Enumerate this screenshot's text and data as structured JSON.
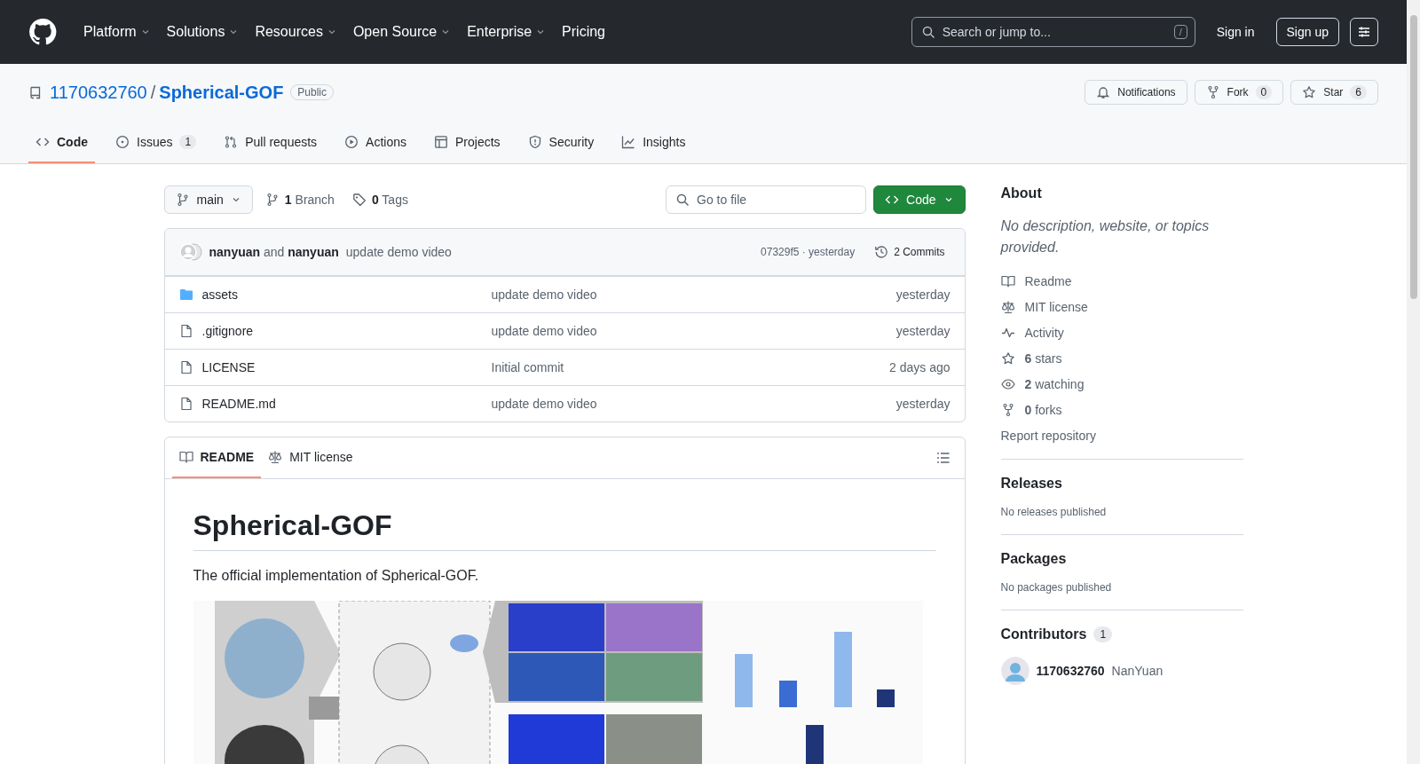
{
  "header": {
    "nav": [
      {
        "label": "Platform",
        "dropdown": true
      },
      {
        "label": "Solutions",
        "dropdown": true
      },
      {
        "label": "Resources",
        "dropdown": true
      },
      {
        "label": "Open Source",
        "dropdown": true
      },
      {
        "label": "Enterprise",
        "dropdown": true
      },
      {
        "label": "Pricing",
        "dropdown": false
      }
    ],
    "search": {
      "placeholder": "Search or jump to...",
      "shortcut": "/"
    },
    "sign_in": "Sign in",
    "sign_up": "Sign up"
  },
  "repo": {
    "owner": "1170632760",
    "separator": "/",
    "name": "Spherical-GOF",
    "visibility": "Public",
    "actions": [
      {
        "kind": "bell",
        "label": "Notifications"
      },
      {
        "kind": "fork",
        "label": "Fork",
        "count": "0"
      },
      {
        "kind": "star",
        "label": "Star",
        "count": "6"
      }
    ]
  },
  "tabs": [
    {
      "kind": "code",
      "label": "Code",
      "selected": true
    },
    {
      "kind": "issue",
      "label": "Issues",
      "count": "1",
      "selected": false
    },
    {
      "kind": "pull",
      "label": "Pull requests",
      "selected": false
    },
    {
      "kind": "play",
      "label": "Actions",
      "selected": false
    },
    {
      "kind": "table",
      "label": "Projects",
      "selected": false
    },
    {
      "kind": "shield",
      "label": "Security",
      "selected": false
    },
    {
      "kind": "graph",
      "label": "Insights",
      "selected": false
    }
  ],
  "toolbar": {
    "branch": "main",
    "branches": "**1** Branch",
    "tags": "**0** Tags",
    "go_to_file": {
      "placeholder": "Go to file"
    },
    "code_button": "Code"
  },
  "commit": {
    "authors": "**nanyuan** and **nanyuan**",
    "message": "update demo video",
    "hash_time": "07329f5 · yesterday",
    "commits": "2 Commits"
  },
  "files": [
    {
      "kind": "folder",
      "name": "assets",
      "message": "update demo video",
      "time": "yesterday"
    },
    {
      "kind": "file",
      "name": ".gitignore",
      "message": "update demo video",
      "time": "yesterday"
    },
    {
      "kind": "file",
      "name": "LICENSE",
      "message": "Initial commit",
      "time": "2 days ago"
    },
    {
      "kind": "file",
      "name": "README.md",
      "message": "update demo video",
      "time": "yesterday"
    }
  ],
  "readme": {
    "tabs": [
      {
        "kind": "book",
        "label": "README",
        "selected": true
      },
      {
        "kind": "law",
        "label": "MIT license",
        "selected": false
      }
    ],
    "title": "Spherical-GOF",
    "text": "The official implementation of Spherical-GOF."
  },
  "sidebar": {
    "about": {
      "heading": "About",
      "description": "No description, website, or topics provided.",
      "links": [
        {
          "kind": "book",
          "text": "Readme"
        },
        {
          "kind": "law",
          "text": "MIT license"
        },
        {
          "kind": "pulse",
          "text": "Activity"
        },
        {
          "kind": "star",
          "text": "**6** stars"
        },
        {
          "kind": "eye",
          "text": "**2** watching"
        },
        {
          "kind": "fork",
          "text": "**0** forks"
        }
      ],
      "report": "Report repository"
    },
    "releases": {
      "heading": "Releases",
      "text": "No releases published"
    },
    "packages": {
      "heading": "Packages",
      "text": "No packages published"
    },
    "contributors": {
      "heading": "Contributors",
      "count": "1",
      "people": [
        {
          "login": "1170632760",
          "name": "NanYuan"
        }
      ]
    }
  }
}
